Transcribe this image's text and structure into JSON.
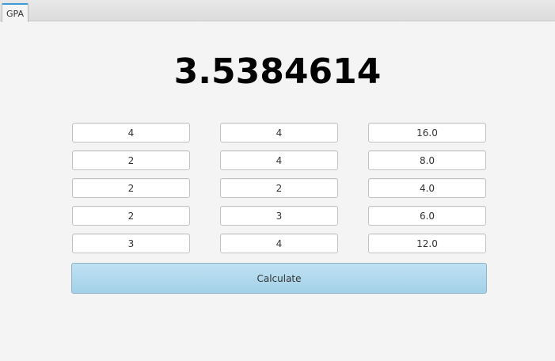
{
  "tabs": [
    {
      "label": "GPA"
    }
  ],
  "result": {
    "value": "3.5384614"
  },
  "rows": [
    {
      "credits": "4",
      "grade": "4",
      "points": "16.0"
    },
    {
      "credits": "2",
      "grade": "4",
      "points": "8.0"
    },
    {
      "credits": "2",
      "grade": "2",
      "points": "4.0"
    },
    {
      "credits": "2",
      "grade": "3",
      "points": "6.0"
    },
    {
      "credits": "3",
      "grade": "4",
      "points": "12.0"
    }
  ],
  "calculate_button": {
    "label": "Calculate"
  },
  "colors": {
    "button": "#a4d1e8",
    "tab_accent": "#3c9bd6",
    "background": "#f4f4f4"
  }
}
